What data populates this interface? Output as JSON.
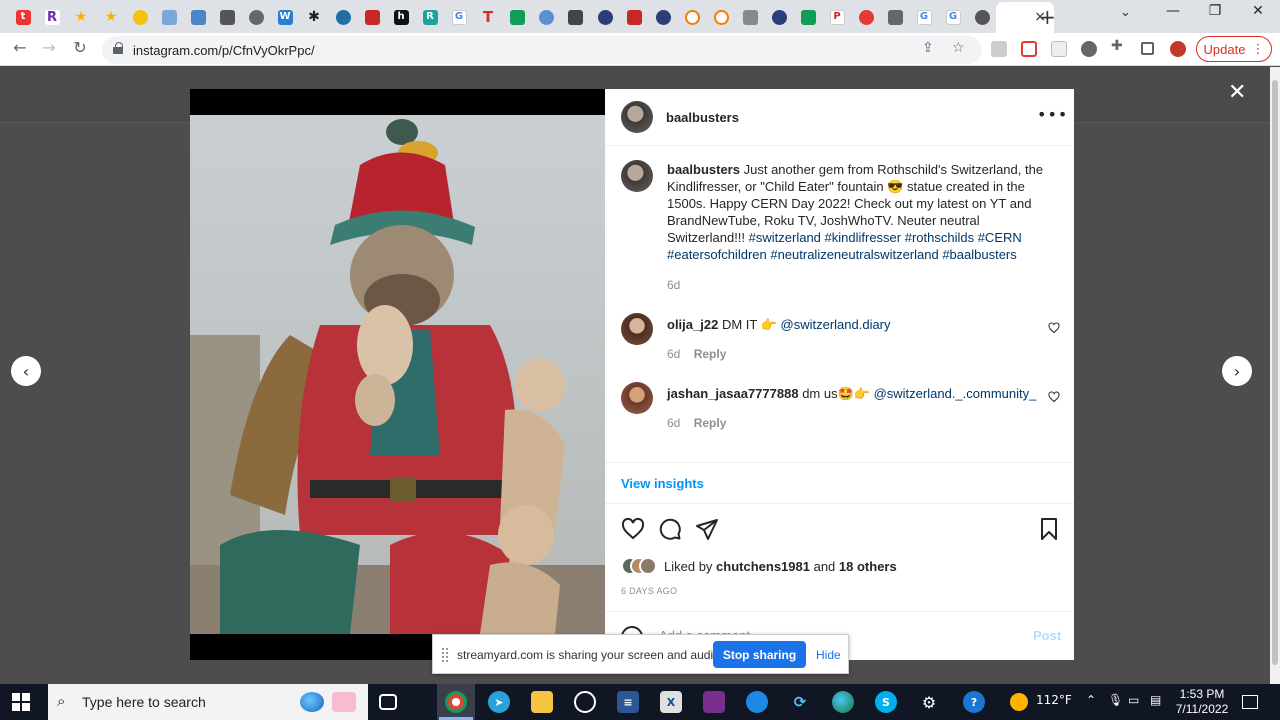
{
  "browser": {
    "active_tab_close": "×",
    "new_tab": "+",
    "url": "instagram.com/p/CfnVyOkrPpc/",
    "update_label": "Update"
  },
  "post": {
    "username": "baalbusters",
    "caption_user": "baalbusters",
    "caption_text": "Just another gem from Rothschild's Switzerland, the Kindlifresser, or \"Child Eater\" fountain 😎 statue created in the 1500s. Happy CERN Day 2022! Check out my latest on YT and BrandNewTube, Roku TV, JoshWhoTV. Neuter neutral Switzerland!!! ",
    "caption_hashtags": "#switzerland #kindlifresser #rothschilds #CERN #eatersofchildren #neutralizeneutralswitzerland #baalbusters",
    "caption_time": "6d",
    "comments": [
      {
        "user": "olija_j22",
        "text": "DM IT 👉 ",
        "mention": "@switzerland.diary",
        "time": "6d",
        "reply": "Reply"
      },
      {
        "user": "jashan_jasaa7777888",
        "text": "dm us🤩👉 ",
        "mention": "@switzerland._.community_",
        "time": "6d",
        "reply": "Reply"
      }
    ],
    "view_insights": "View insights",
    "liked_prefix": "Liked by ",
    "liked_user": "chutchens1981",
    "liked_and": " and ",
    "liked_others": "18 others",
    "days_ago": "6 DAYS AGO",
    "add_comment_placeholder": "Add a comment...",
    "post_label": "Post"
  },
  "share_banner": {
    "text": "streamyard.com is sharing your screen and audio.",
    "stop_label": "Stop sharing",
    "hide_label": "Hide"
  },
  "taskbar": {
    "search_placeholder": "Type here to search",
    "weather": "112°F",
    "time": "1:53 PM",
    "date": "7/11/2022"
  },
  "colors": {
    "accent_blue": "#0095f6",
    "hashtag_blue": "#00376b",
    "update_red": "#d93025"
  }
}
